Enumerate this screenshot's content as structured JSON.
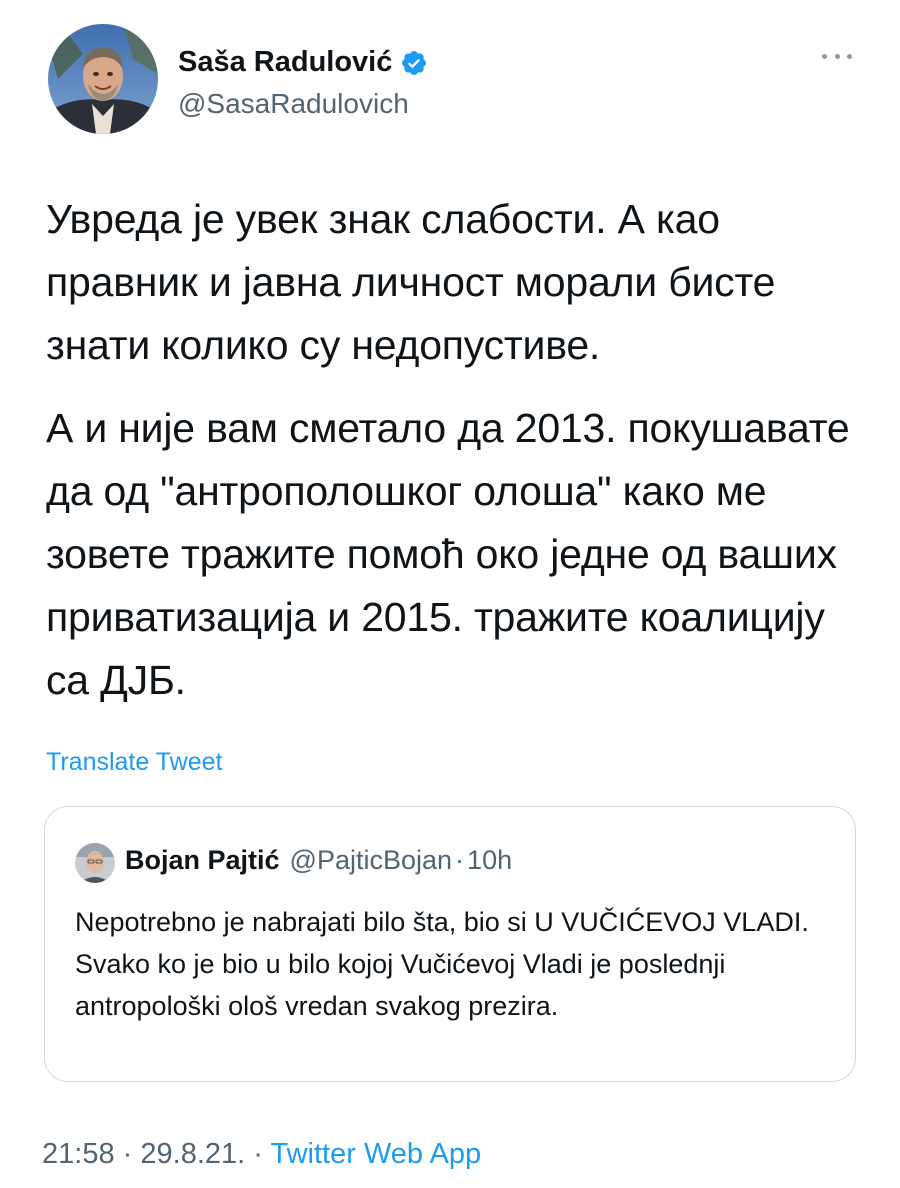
{
  "author": {
    "name": "Saša Radulović",
    "handle": "@SasaRadulovich",
    "verified": true
  },
  "more_icon": "more-horizontal-icon",
  "tweet": {
    "paragraphs": [
      "Увреда је увек знак слабости. А као правник и јавна личност морали бисте знати колико су недопустиве.",
      "А и није вам сметало да 2013. покушавате да од \"антрополошког олоша\" како ме зовете тражите помоћ око једне од ваших приватизација и 2015. тражите коалицију са ДЈБ."
    ],
    "translate_label": "Translate Tweet"
  },
  "quoted_tweet": {
    "name": "Bojan Pajtić",
    "handle": "@PajticBojan",
    "separator": "·",
    "time": "10h",
    "text": "Nepotrebno je nabrajati bilo šta, bio si U VUČIĆEVOJ VLADI. Svako ko je bio u bilo kojoj Vučićevoj Vladi je poslednji antropološki ološ vredan svakog prezira."
  },
  "footer": {
    "time": "21:58",
    "separator": "·",
    "date": "29.8.21.",
    "separator2": "·",
    "source": "Twitter Web App"
  },
  "colors": {
    "accent": "#1d9bf0",
    "text": "#0f1419",
    "muted": "#536471",
    "border": "#cfd9de"
  }
}
